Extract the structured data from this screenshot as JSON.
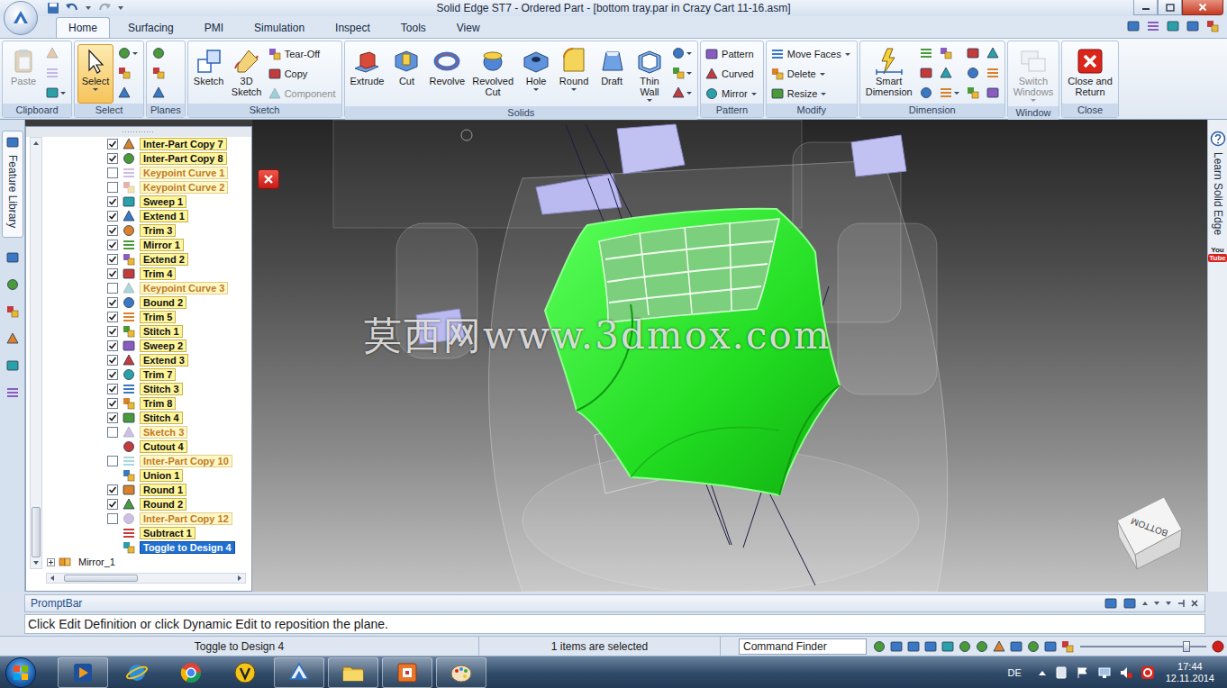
{
  "window": {
    "title": "Solid Edge ST7 - Ordered Part - [bottom tray.par in Crazy Cart 11-16.asm]"
  },
  "ribbon_tabs": [
    {
      "label": "Home",
      "selected": true
    },
    {
      "label": "Surfacing",
      "selected": false
    },
    {
      "label": "PMI",
      "selected": false
    },
    {
      "label": "Simulation",
      "selected": false
    },
    {
      "label": "Inspect",
      "selected": false
    },
    {
      "label": "Tools",
      "selected": false
    },
    {
      "label": "View",
      "selected": false
    }
  ],
  "ribbon_groups": [
    {
      "label": "Clipboard",
      "items": [
        {
          "kind": "large",
          "lines": [
            "Paste"
          ],
          "disabled": true,
          "selected": false,
          "dropdown": false
        },
        {
          "kind": "icons",
          "icons": [
            {
              "disabled": true,
              "dropdown": false
            },
            {
              "disabled": true,
              "dropdown": false
            },
            {
              "disabled": false,
              "dropdown": true
            }
          ]
        }
      ]
    },
    {
      "label": "Select",
      "items": [
        {
          "kind": "large",
          "lines": [
            "Select"
          ],
          "disabled": false,
          "selected": true,
          "dropdown": true
        },
        {
          "kind": "icons",
          "icons": [
            {
              "disabled": false,
              "dropdown": true
            },
            {
              "disabled": false,
              "dropdown": false
            },
            {
              "disabled": false,
              "dropdown": false
            }
          ]
        }
      ]
    },
    {
      "label": "Planes",
      "items": [
        {
          "kind": "icons",
          "icons": [
            {
              "disabled": false,
              "dropdown": false
            },
            {
              "disabled": false,
              "dropdown": false
            },
            {
              "disabled": false,
              "dropdown": false
            }
          ]
        }
      ]
    },
    {
      "label": "Sketch",
      "items": [
        {
          "kind": "large",
          "lines": [
            "Sketch"
          ],
          "disabled": false,
          "selected": false,
          "dropdown": false
        },
        {
          "kind": "large",
          "lines": [
            "3D",
            "Sketch"
          ],
          "disabled": false,
          "selected": false,
          "dropdown": false
        },
        {
          "kind": "small",
          "buttons": [
            {
              "label": "Tear-Off",
              "disabled": false,
              "dropdown": false
            },
            {
              "label": "Copy",
              "disabled": false,
              "dropdown": false
            },
            {
              "label": "Component",
              "disabled": true,
              "dropdown": false
            }
          ]
        }
      ]
    },
    {
      "label": "Solids",
      "items": [
        {
          "kind": "large",
          "lines": [
            "Extrude"
          ],
          "disabled": false,
          "selected": false,
          "dropdown": false
        },
        {
          "kind": "large",
          "lines": [
            "Cut"
          ],
          "disabled": false,
          "selected": false,
          "dropdown": false
        },
        {
          "kind": "large",
          "lines": [
            "Revolve"
          ],
          "disabled": false,
          "selected": false,
          "dropdown": false
        },
        {
          "kind": "large",
          "lines": [
            "Revolved",
            "Cut"
          ],
          "disabled": false,
          "selected": false,
          "dropdown": false
        },
        {
          "kind": "large",
          "lines": [
            "Hole"
          ],
          "disabled": false,
          "selected": false,
          "dropdown": true
        },
        {
          "kind": "large",
          "lines": [
            "Round"
          ],
          "disabled": false,
          "selected": false,
          "dropdown": true
        },
        {
          "kind": "large",
          "lines": [
            "Draft"
          ],
          "disabled": false,
          "selected": false,
          "dropdown": false
        },
        {
          "kind": "large",
          "lines": [
            "Thin",
            "Wall"
          ],
          "disabled": false,
          "selected": false,
          "dropdown": true
        },
        {
          "kind": "icons",
          "icons": [
            {
              "disabled": false,
              "dropdown": true
            },
            {
              "disabled": false,
              "dropdown": true
            },
            {
              "disabled": false,
              "dropdown": true
            }
          ]
        }
      ]
    },
    {
      "label": "Pattern",
      "items": [
        {
          "kind": "small",
          "buttons": [
            {
              "label": "Pattern",
              "disabled": false,
              "dropdown": false
            },
            {
              "label": "Curved",
              "disabled": false,
              "dropdown": false
            },
            {
              "label": "Mirror",
              "disabled": false,
              "dropdown": true
            }
          ]
        }
      ]
    },
    {
      "label": "Modify",
      "items": [
        {
          "kind": "small",
          "buttons": [
            {
              "label": "Move Faces",
              "disabled": false,
              "dropdown": true
            },
            {
              "label": "Delete",
              "disabled": false,
              "dropdown": true
            },
            {
              "label": "Resize",
              "disabled": false,
              "dropdown": true
            }
          ]
        }
      ]
    },
    {
      "label": "Dimension",
      "items": [
        {
          "kind": "large",
          "lines": [
            "Smart",
            "Dimension"
          ],
          "disabled": false,
          "selected": false,
          "dropdown": false
        },
        {
          "kind": "icons",
          "icons": [
            {
              "disabled": false,
              "dropdown": false
            },
            {
              "disabled": false,
              "dropdown": false
            },
            {
              "disabled": false,
              "dropdown": false
            }
          ]
        },
        {
          "kind": "icons",
          "icons": [
            {
              "disabled": false,
              "dropdown": false
            },
            {
              "disabled": false,
              "dropdown": false
            },
            {
              "disabled": false,
              "dropdown": true
            }
          ]
        },
        {
          "kind": "icons",
          "icons": [
            {
              "disabled": false,
              "dropdown": false
            },
            {
              "disabled": false,
              "dropdown": false
            },
            {
              "disabled": false,
              "dropdown": false
            }
          ]
        },
        {
          "kind": "icons",
          "icons": [
            {
              "disabled": false,
              "dropdown": false
            },
            {
              "disabled": false,
              "dropdown": false
            },
            {
              "disabled": false,
              "dropdown": false
            }
          ]
        }
      ]
    },
    {
      "label": "Window",
      "items": [
        {
          "kind": "large",
          "lines": [
            "Switch",
            "Windows"
          ],
          "disabled": true,
          "selected": false,
          "dropdown": true
        }
      ]
    },
    {
      "label": "Close",
      "items": [
        {
          "kind": "large",
          "lines": [
            "Close and",
            "Return"
          ],
          "disabled": false,
          "selected": false,
          "dropdown": false
        }
      ]
    }
  ],
  "left_strip": {
    "label": "Feature Library",
    "selected": true
  },
  "tree": {
    "vscroll_level": 1,
    "hscroll_level": 0.06,
    "rows": [
      {
        "kind": "feature",
        "label": "Inter-Part Copy 7",
        "checked": true,
        "dimmed": false,
        "selected": false
      },
      {
        "kind": "feature",
        "label": "Inter-Part Copy 8",
        "checked": true,
        "dimmed": false,
        "selected": false
      },
      {
        "kind": "feature",
        "label": "Keypoint Curve 1",
        "checked": false,
        "dimmed": true,
        "selected": false
      },
      {
        "kind": "feature",
        "label": "Keypoint Curve 2",
        "checked": false,
        "dimmed": true,
        "selected": false
      },
      {
        "kind": "feature",
        "label": "Sweep 1",
        "checked": true,
        "dimmed": false,
        "selected": false
      },
      {
        "kind": "feature",
        "label": "Extend 1",
        "checked": true,
        "dimmed": false,
        "selected": false
      },
      {
        "kind": "feature",
        "label": "Trim 3",
        "checked": true,
        "dimmed": false,
        "selected": false
      },
      {
        "kind": "feature",
        "label": "Mirror 1",
        "checked": true,
        "dimmed": false,
        "selected": false
      },
      {
        "kind": "feature",
        "label": "Extend 2",
        "checked": true,
        "dimmed": false,
        "selected": false
      },
      {
        "kind": "feature",
        "label": "Trim 4",
        "checked": true,
        "dimmed": false,
        "selected": false
      },
      {
        "kind": "feature",
        "label": "Keypoint Curve 3",
        "checked": false,
        "dimmed": true,
        "selected": false
      },
      {
        "kind": "feature",
        "label": "Bound 2",
        "checked": true,
        "dimmed": false,
        "selected": false
      },
      {
        "kind": "feature",
        "label": "Trim 5",
        "checked": true,
        "dimmed": false,
        "selected": false
      },
      {
        "kind": "feature",
        "label": "Stitch 1",
        "checked": true,
        "dimmed": false,
        "selected": false
      },
      {
        "kind": "feature",
        "label": "Sweep 2",
        "checked": true,
        "dimmed": false,
        "selected": false
      },
      {
        "kind": "feature",
        "label": "Extend 3",
        "checked": true,
        "dimmed": false,
        "selected": false
      },
      {
        "kind": "feature",
        "label": "Trim 7",
        "checked": true,
        "dimmed": false,
        "selected": false
      },
      {
        "kind": "feature",
        "label": "Stitch 3",
        "checked": true,
        "dimmed": false,
        "selected": false
      },
      {
        "kind": "feature",
        "label": "Trim 8",
        "checked": true,
        "dimmed": false,
        "selected": false
      },
      {
        "kind": "feature",
        "label": "Stitch 4",
        "checked": true,
        "dimmed": false,
        "selected": false
      },
      {
        "kind": "feature",
        "label": "Sketch 3",
        "checked": false,
        "dimmed": true,
        "selected": false
      },
      {
        "kind": "operation",
        "label": "Cutout 4",
        "dimmed": false,
        "selected": false
      },
      {
        "kind": "feature",
        "label": "Inter-Part Copy 10",
        "checked": false,
        "dimmed": true,
        "selected": false
      },
      {
        "kind": "operation",
        "label": "Union 1",
        "dimmed": false,
        "selected": false
      },
      {
        "kind": "feature",
        "label": "Round 1",
        "checked": true,
        "dimmed": false,
        "selected": false
      },
      {
        "kind": "feature",
        "label": "Round 2",
        "checked": true,
        "dimmed": false,
        "selected": false
      },
      {
        "kind": "feature",
        "label": "Inter-Part Copy 12",
        "checked": false,
        "dimmed": true,
        "selected": false
      },
      {
        "kind": "operation",
        "label": "Subtract 1",
        "dimmed": false,
        "selected": false
      },
      {
        "kind": "operation",
        "label": "Toggle to Design 4",
        "dimmed": false,
        "selected": true
      },
      {
        "kind": "group",
        "label": "Mirror_1",
        "expanded": false
      }
    ]
  },
  "viewport": {
    "watermark": "莫西网www.3dmox.com",
    "view_cube": "BOTTOM"
  },
  "right_strip": {
    "label": "Learn Solid Edge",
    "logo": [
      "You",
      "Tube"
    ]
  },
  "prompt_bar": {
    "title": "PromptBar",
    "message": "Click Edit Definition or click Dynamic Edit to reposition the plane."
  },
  "status_bar": {
    "command": "Toggle to Design 4",
    "selection": "1 items are selected",
    "search": {
      "placeholder": "Command Finder"
    },
    "zoom": {
      "level": 0.86
    }
  },
  "taskbar": {
    "apps": [
      {
        "open": true
      },
      {
        "open": false
      },
      {
        "open": false
      },
      {
        "open": false
      },
      {
        "open": true
      },
      {
        "open": true
      },
      {
        "open": true
      },
      {
        "open": true
      }
    ],
    "language": "DE",
    "time": "17:44",
    "date": "12.11.2014"
  }
}
